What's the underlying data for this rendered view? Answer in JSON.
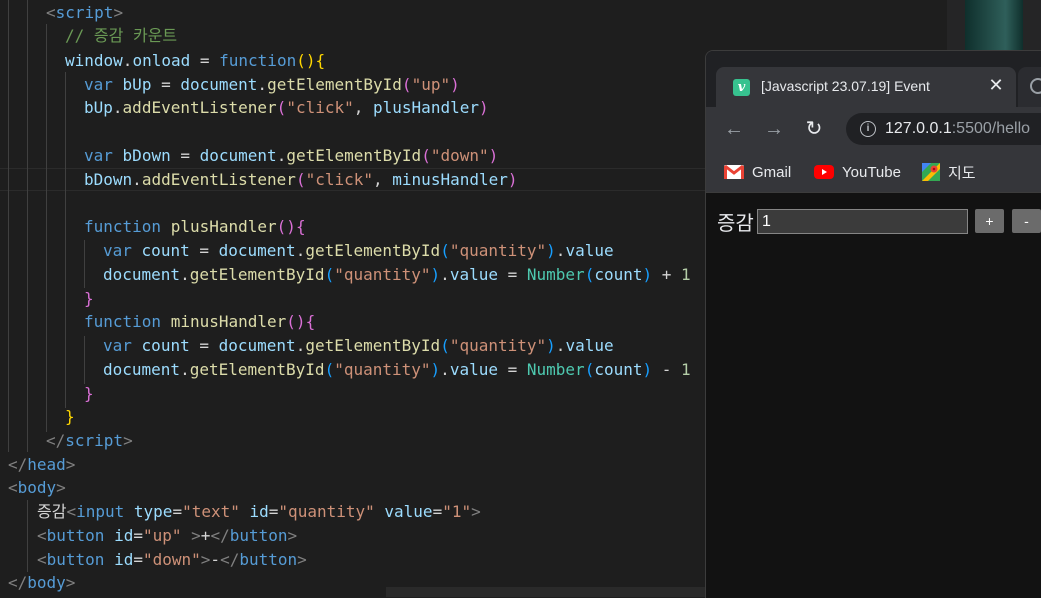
{
  "editor": {
    "code_tokens": {
      "script_open": "script",
      "comment": "// 증감 카운트",
      "window": "window",
      "onload": "onload",
      "function_kw": "function",
      "var_kw": "var",
      "bUp": "bUp",
      "bDown": "bDown",
      "document": "document",
      "getElementById": "getElementById",
      "addEventListener": "addEventListener",
      "str_up": "\"up\"",
      "str_down": "\"down\"",
      "str_click": "\"click\"",
      "plusHandler": "plusHandler",
      "minusHandler": "minusHandler",
      "count": "count",
      "str_quantity": "\"quantity\"",
      "value": "value",
      "Number": "Number",
      "one": "1",
      "head": "head",
      "body": "body",
      "label_text": "증감",
      "input": "input",
      "type_attr": "type",
      "str_text": "\"text\"",
      "id_attr": "id",
      "str_quantity_attr": "\"quantity\"",
      "value_attr": "value",
      "str_one": "\"1\"",
      "button": "button",
      "str_up_attr": "\"up\"",
      "str_down_attr": "\"down\"",
      "plus": "+",
      "minus": "-"
    }
  },
  "browser": {
    "tab": {
      "favicon": "v",
      "title": "[Javascript 23.07.19] Event",
      "close": "✕"
    },
    "toolbar": {
      "back": "←",
      "forward": "→",
      "reload": "↻",
      "url_host": "127.0.0.1",
      "url_path": ":5500/hello"
    },
    "bookmarks": [
      {
        "label": "Gmail",
        "icon": "gmail-icon"
      },
      {
        "label": "YouTube",
        "icon": "youtube-icon"
      },
      {
        "label": "지도",
        "icon": "maps-icon"
      }
    ],
    "page": {
      "label": "증감",
      "quantity_value": "1",
      "plus_label": "+",
      "minus_label": "-"
    }
  },
  "colors": {
    "editor_bg": "#1e1e1e",
    "tag": "#569cd6",
    "string": "#ce9178",
    "comment": "#6a9955",
    "function": "#dcdcaa",
    "variable": "#9cdcfe",
    "type": "#4ec9b0",
    "browser_bg": "#202124",
    "page_bg": "#121212"
  }
}
